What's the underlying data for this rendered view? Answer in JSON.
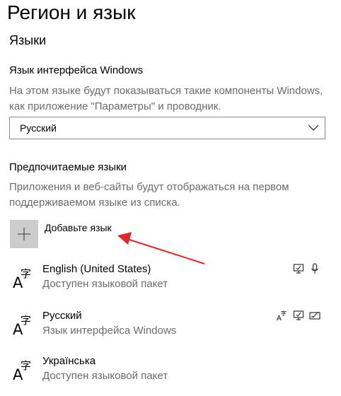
{
  "page": {
    "title": "Регион и язык"
  },
  "languages_section": {
    "title": "Языки",
    "display_language": {
      "label": "Язык интерфейса Windows",
      "description": "На этом языке будут показываться такие компоненты Windows, как приложение \"Параметры\" и проводник.",
      "selected": "Русский"
    },
    "preferred": {
      "label": "Предпочитаемые языки",
      "description": "Приложения и веб-сайты будут отображаться на первом поддерживаемом языке из списка.",
      "add_label": "Добавьте язык",
      "items": [
        {
          "name": "English (United States)",
          "status": "Доступен языковой пакет",
          "features": [
            "display-icon",
            "speech-icon"
          ]
        },
        {
          "name": "Русский",
          "status": "Язык интерфейса Windows",
          "features": [
            "language-pack-icon",
            "display-icon",
            "handwriting-icon"
          ]
        },
        {
          "name": "Українська",
          "status": "Доступен языковой пакет",
          "features": []
        }
      ]
    }
  },
  "annotation": {
    "arrow_color": "#e0252b"
  }
}
